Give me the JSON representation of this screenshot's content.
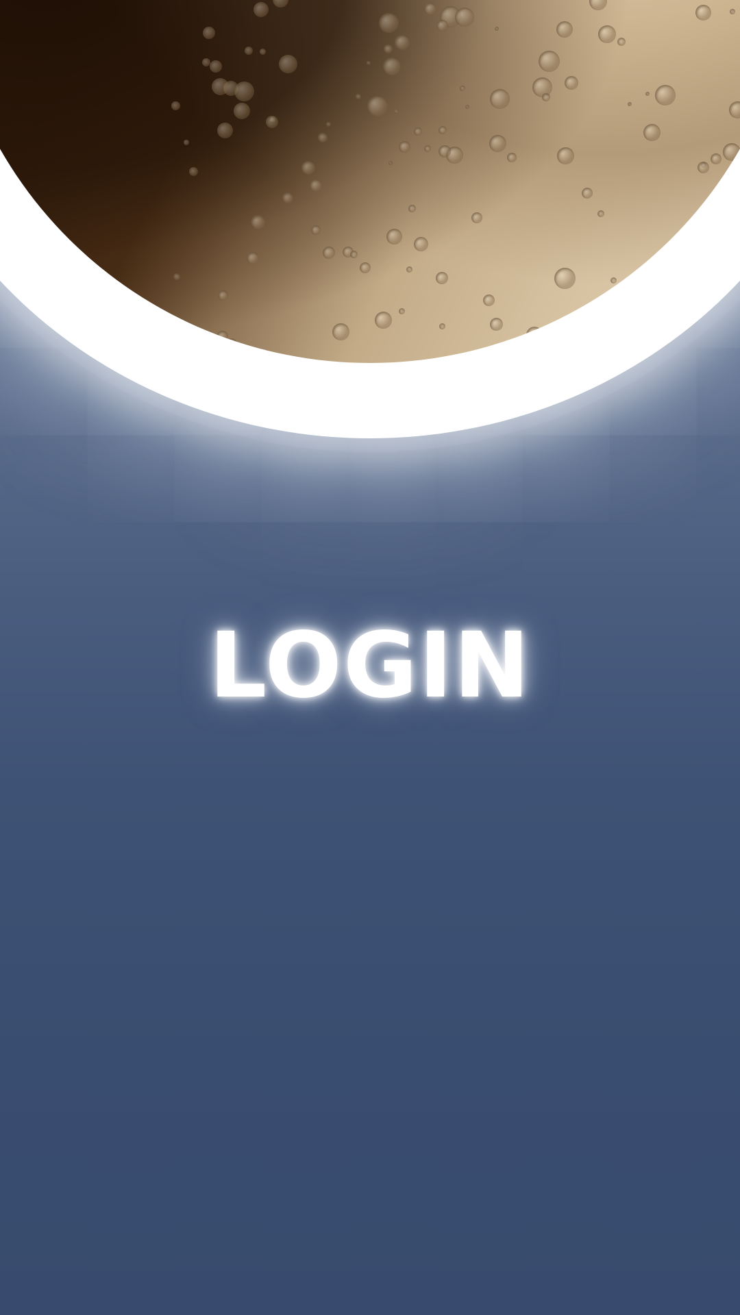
{
  "screen": {
    "login_label": "LOGIN"
  },
  "colors": {
    "background": "#384b6e",
    "glow": "#ffffff",
    "moon_light": "#ddc8a8",
    "moon_dark": "#2a1608"
  },
  "icons": {
    "moon": "moon-icon"
  }
}
